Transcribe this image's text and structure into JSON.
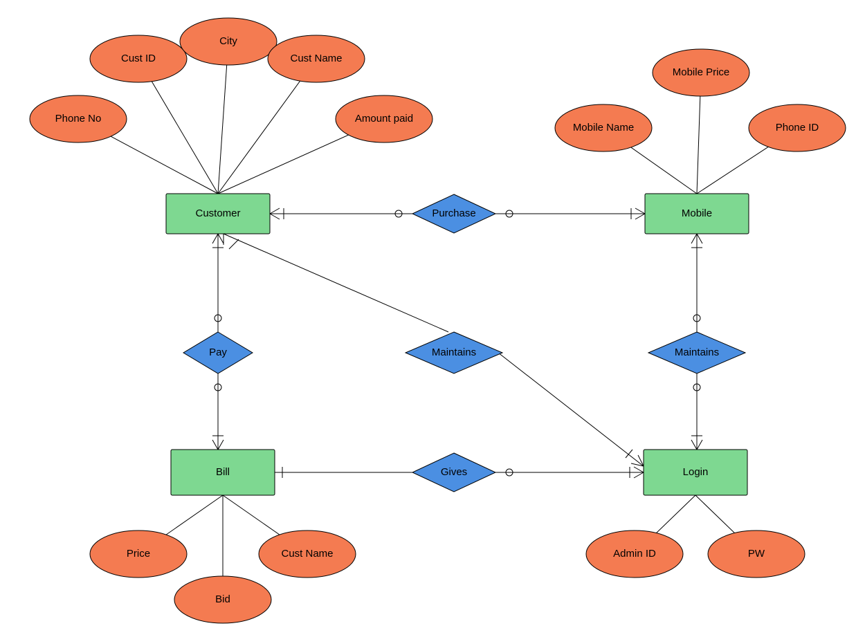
{
  "entities": {
    "customer": "Customer",
    "mobile": "Mobile",
    "bill": "Bill",
    "login": "Login"
  },
  "attributes": {
    "phone_no": "Phone No",
    "cust_id": "Cust ID",
    "city": "City",
    "cust_name": "Cust Name",
    "amount_paid": "Amount paid",
    "mobile_name": "Mobile Name",
    "mobile_price": "Mobile Price",
    "phone_id": "Phone ID",
    "price": "Price",
    "bid": "Bid",
    "cust_name_bill": "Cust Name",
    "admin_id": "Admin ID",
    "pw": "PW"
  },
  "relationships": {
    "purchase": "Purchase",
    "pay": "Pay",
    "maintains1": "Maintains",
    "maintains2": "Maintains",
    "gives": "Gives"
  }
}
